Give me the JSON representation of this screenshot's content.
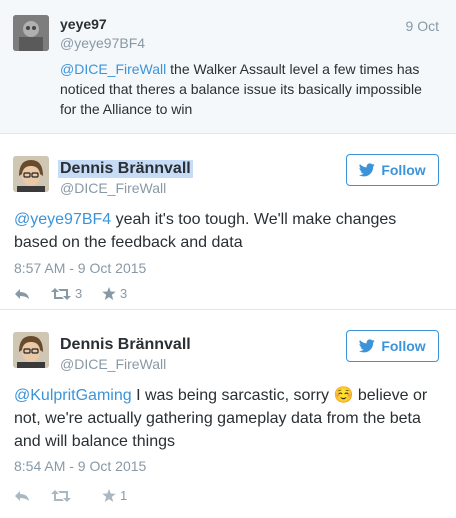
{
  "context_tweet": {
    "name": "yeye97",
    "handle": "@yeye97BF4",
    "time": "9 Oct",
    "mention": "@DICE_FireWall",
    "text": " the Walker Assault level a few times has noticed that theres a balance issue its basically impossible for the Alliance to win"
  },
  "tweets": [
    {
      "name": "Dennis Brännvall",
      "handle": "@DICE_FireWall",
      "follow_label": "Follow",
      "mention": "@yeye97BF4",
      "text": " yeah it's too tough. We'll make changes based on the feedback and data",
      "timestamp": "8:57 AM - 9 Oct 2015",
      "retweets": "3",
      "favorites": "3"
    },
    {
      "name": "Dennis Brännvall",
      "handle": "@DICE_FireWall",
      "follow_label": "Follow",
      "mention": "@KulpritGaming",
      "text_before_emoji": " I was being sarcastic, sorry ",
      "emoji": "☺️",
      "text_after_emoji": " believe or not, we're actually gathering gameplay data from the beta and will balance things",
      "timestamp": "8:54 AM - 9 Oct 2015",
      "favorites": "1"
    }
  ],
  "colors": {
    "link": "#3b94d9",
    "secondary_text": "#8899a6",
    "context_background": "#f5f8fa",
    "name_highlight": "#c6dbf5"
  },
  "icons": {
    "reply": "reply-icon",
    "retweet": "retweet-icon",
    "favorite": "star-icon",
    "follow": "twitter-bird-icon"
  }
}
